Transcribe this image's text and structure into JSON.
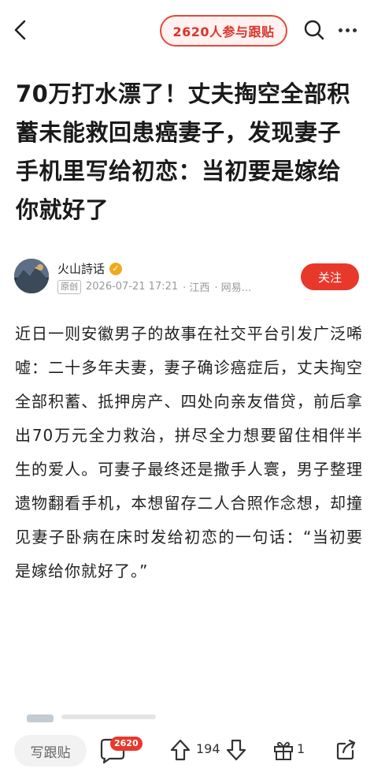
{
  "topbar": {
    "pill_label": "2620人参与跟贴",
    "icons": [
      "back-arrow-icon",
      "search-icon",
      "more-icon"
    ]
  },
  "article": {
    "title": "70万打水漂了！丈夫掏空全部积蓄未能救回患癌妻子，发现妻子手机里写给初恋：当初要是嫁给你就好了",
    "author_name": "火山詩话",
    "original_tag": "原创",
    "date": "2026-07-21 17:21",
    "location": "· 江西",
    "source": "· 网易...",
    "follow_label": "关注",
    "body": "近日一则安徽男子的故事在社交平台引发广泛唏嘘：二十多年夫妻，妻子确诊癌症后，丈夫掏空全部积蓄、抵押房产、四处向亲友借贷，前后拿出70万元全力救治，拼尽全力想要留住相伴半生的爱人。可妻子最终还是撒手人寰，男子整理遗物翻看手机，本想留存二人合照作念想，却撞见妻子卧病在床时发给初恋的一句话：“当初要是嫁给你就好了。”"
  },
  "bottombar": {
    "reply_label": "写跟贴",
    "comment_count": "2620",
    "vote_count": "194",
    "gift_count": "1"
  },
  "colors": {
    "accent": "#e8382c",
    "pill_bg": "#fff2f0"
  }
}
